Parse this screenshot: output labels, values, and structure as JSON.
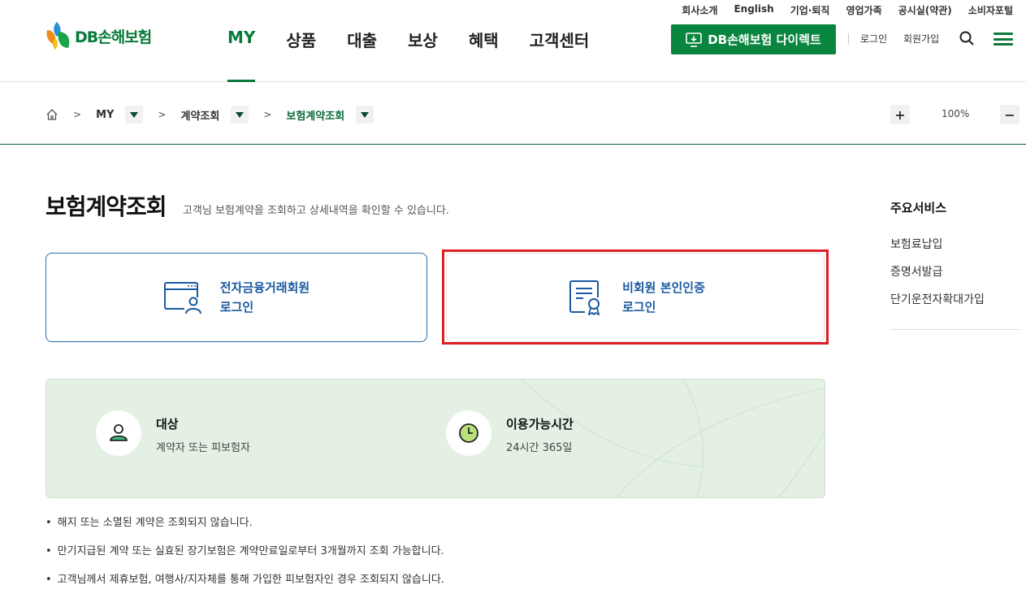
{
  "util_links": [
    "회사소개",
    "English",
    "기업·퇴직",
    "영업가족",
    "공시실(약관)",
    "소비자포털"
  ],
  "logo": {
    "text": "DB손해보험"
  },
  "gnb": [
    {
      "label": "MY",
      "active": true
    },
    {
      "label": "상품",
      "active": false
    },
    {
      "label": "대출",
      "active": false
    },
    {
      "label": "보상",
      "active": false
    },
    {
      "label": "혜택",
      "active": false
    },
    {
      "label": "고객센터",
      "active": false
    }
  ],
  "header": {
    "direct_button": "DB손해보험 다이렉트",
    "login": "로그인",
    "join": "회원가입"
  },
  "breadcrumb": {
    "items": [
      "MY",
      "계약조회",
      "보험계약조회"
    ],
    "zoom": "100%"
  },
  "page": {
    "title": "보험계약조회",
    "description": "고객님 보험계약을 조회하고 상세내역을 확인할 수 있습니다."
  },
  "cards": [
    {
      "line1": "전자금융거래회원",
      "line2": "로그인"
    },
    {
      "line1": "비회원 본인인증",
      "line2": "로그인"
    }
  ],
  "info": {
    "target": {
      "title": "대상",
      "desc": "계약자 또는 피보험자"
    },
    "hours": {
      "title": "이용가능시간",
      "desc": "24시간 365일"
    }
  },
  "notes": [
    "해지 또는 소멸된 계약은 조회되지 않습니다.",
    "만기지급된 계약 또는 실효된 장기보험은 계약만료일로부터 3개월까지 조회 가능합니다.",
    "고객님께서 제휴보험, 여행사/지자체를 통해 가입한 피보험자인 경우 조회되지 않습니다."
  ],
  "side": {
    "title": "주요서비스",
    "items": [
      "보험료납입",
      "증명서발급",
      "단기운전자확대가입"
    ]
  },
  "colors": {
    "brand_green": "#0a8540",
    "link_blue": "#1a5aa0",
    "highlight_red": "#e01c24"
  }
}
